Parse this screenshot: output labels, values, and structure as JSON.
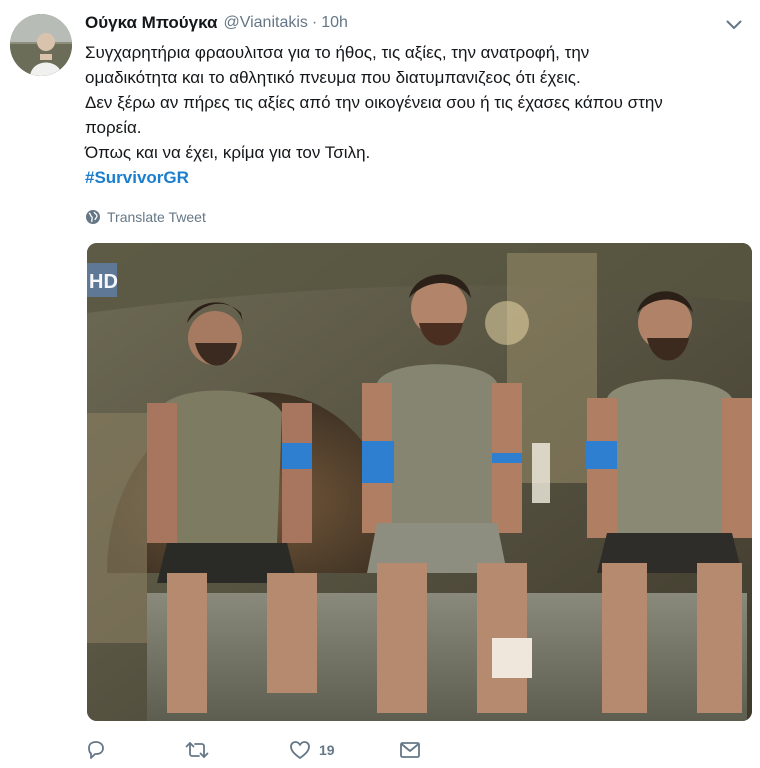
{
  "tweet": {
    "display_name": "Ούγκα Μπούγκα",
    "handle": "@Vianitakis",
    "separator": "·",
    "time": "10h",
    "text_lines": [
      "Συγχαρητήρια φραουλιτσα για το ήθος, τις αξίες, την ανατροφή, την",
      "ομαδικότητα και το αθλητικό πνευμα που διατυμπανιζεος ότι έχεις.",
      "Δεν ξέρω αν πήρες τις αξίες από την οικογένεια σου ή τις έχασες κάπου στην",
      "πορεία.",
      "Όπως και να έχει, κρίμα για τον Τσιλη."
    ],
    "hashtag": "#SurvivorGR",
    "translate_label": "Translate Tweet",
    "media": {
      "channel_badge": "HD"
    },
    "actions": {
      "reply_count": "",
      "retweet_count": "",
      "like_count": "19"
    }
  },
  "colors": {
    "text": "#14171a",
    "secondary": "#657786",
    "link": "#1b7ecf",
    "armband": "#2f7fd0"
  },
  "icons": [
    "avatar",
    "chevron-down-icon",
    "globe-icon",
    "reply-icon",
    "retweet-icon",
    "heart-icon",
    "message-icon"
  ]
}
